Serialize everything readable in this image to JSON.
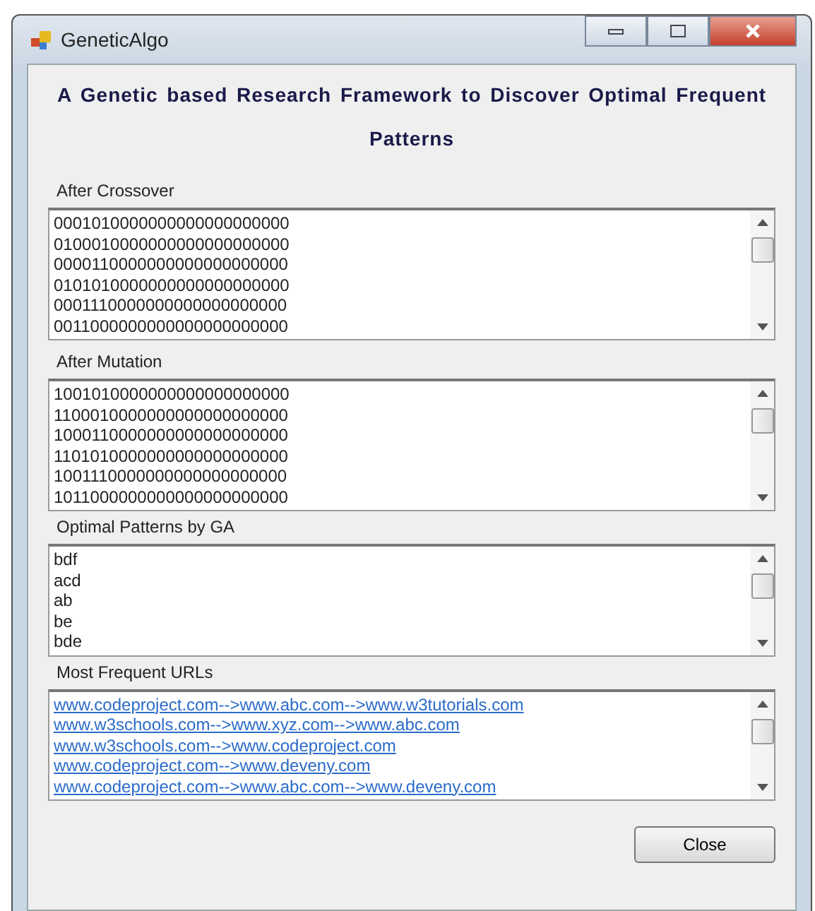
{
  "window": {
    "title": "GeneticAlgo"
  },
  "heading": "A Genetic based Research Framework to Discover Optimal Frequent Patterns",
  "sections": [
    {
      "label": "After Crossover",
      "kind": "text",
      "lines": [
        "0001010000000000000000000",
        "0100010000000000000000000",
        "0000110000000000000000000",
        "0101010000000000000000000",
        "0001110000000000000000000",
        "0011000000000000000000000"
      ]
    },
    {
      "label": "After Mutation",
      "kind": "text",
      "lines": [
        "1001010000000000000000000",
        "1100010000000000000000000",
        "1000110000000000000000000",
        "1101010000000000000000000",
        "1001110000000000000000000",
        "1011000000000000000000000"
      ]
    },
    {
      "label": "Optimal Patterns by GA",
      "kind": "text",
      "lines": [
        "bdf",
        "acd",
        "ab",
        "be",
        "bde"
      ]
    },
    {
      "label": "Most Frequent URLs",
      "kind": "link",
      "lines": [
        "www.codeproject.com-->www.abc.com-->www.w3tutorials.com",
        "www.w3schools.com-->www.xyz.com-->www.abc.com",
        "www.w3schools.com-->www.codeproject.com",
        "www.codeproject.com-->www.deveny.com",
        "www.codeproject.com-->www.abc.com-->www.deveny.com"
      ]
    }
  ],
  "buttons": [
    "Close"
  ]
}
